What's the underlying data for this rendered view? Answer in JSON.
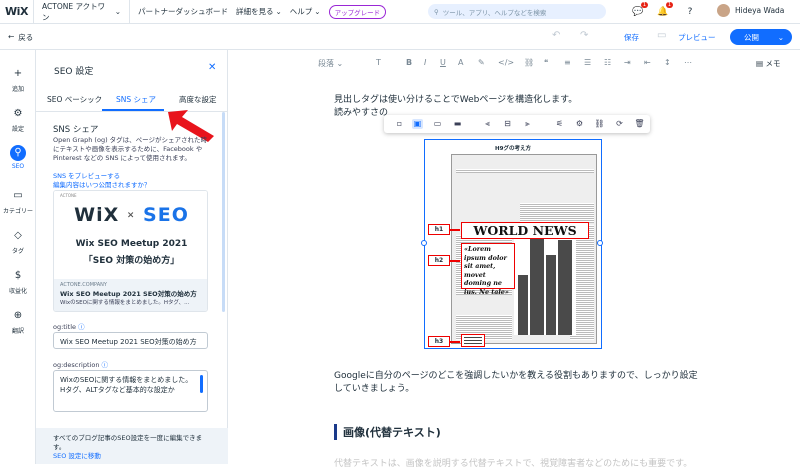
{
  "topbar": {
    "logo": "WiX",
    "site_name": "ACTONE アクトワン",
    "nav": [
      "パートナーダッシュボード",
      "詳細を見る",
      "ヘルプ"
    ],
    "upgrade": "アップグレード",
    "search_placeholder": "ツール、アプリ、ヘルプなどを検索",
    "notifications": {
      "chat": "1",
      "bell": "1"
    },
    "user_name": "Hideya Wada"
  },
  "subbar": {
    "back": "戻る",
    "save": "保存",
    "preview": "プレビュー",
    "publish": "公開"
  },
  "left_rail": [
    {
      "icon": "plus-icon",
      "label": "追加"
    },
    {
      "icon": "gear-icon",
      "label": "設定"
    },
    {
      "icon": "seo-icon",
      "label": "SEO"
    },
    {
      "icon": "folder-icon",
      "label": "カテゴリー"
    },
    {
      "icon": "tag-icon",
      "label": "タグ"
    },
    {
      "icon": "coin-icon",
      "label": "収益化"
    },
    {
      "icon": "globe-icon",
      "label": "翻訳"
    }
  ],
  "panel": {
    "title": "SEO 設定",
    "tabs": [
      "SEO ベーシック",
      "SNS シェア",
      "高度な設定"
    ],
    "section_title": "SNS シェア",
    "section_desc": "Open Graph (og) タグは、ページがシェアされた時にテキストや画像を表示するために、Facebook や Pinterest などの SNS によって使用されます。",
    "preview_link": "SNS をプレビューする",
    "when_link": "編集内容はいつ公開されますか？",
    "card": {
      "brand": "ACTONE",
      "logo_left": "WiX",
      "logo_x": "×",
      "logo_right": "SEO",
      "line1": "Wix SEO Meetup 2021",
      "line2": "「SEO 対策の始め方」",
      "site": "ACTONE.COMPANY",
      "title": "Wix SEO Meetup 2021 SEO対策の始め方",
      "desc": "WixのSEOに関する情報をまとめました。Hタグ、..."
    },
    "og_title_label": "og:title",
    "og_title_value": "Wix SEO Meetup 2021 SEO対策の始め方",
    "og_desc_label": "og:description",
    "og_desc_value": "WixのSEOに関する情報をまとめました。Hタグ、ALTタグなど基本的な設定か",
    "footer_text": "すべてのブログ記事のSEO設定を一度に編集できます。",
    "footer_link": "SEO 設定に移動"
  },
  "editor": {
    "paragraph_style": "段落",
    "memo": "メモ",
    "text1": "見出しタグは使い分けることでWebページを構造化します。",
    "text2": "読みやすさの",
    "image_caption": "H9グの考え方",
    "newspaper": {
      "title": "WORLD NEWS",
      "lorem": "«Lorem ipsum dolor sit amet, movet doming ne ius. Ne tale»",
      "tags": [
        "h1",
        "h2",
        "h3"
      ]
    },
    "text3": "Googleに自分のページのどこを強調したいかを教える役割もありますので、しっかり設定",
    "text4": "していきましょう。",
    "heading": "画像(代替テキスト)",
    "faded": "代替テキストは、画像を説明する代替テキストで、視覚障害者などのためにも重要です。"
  }
}
